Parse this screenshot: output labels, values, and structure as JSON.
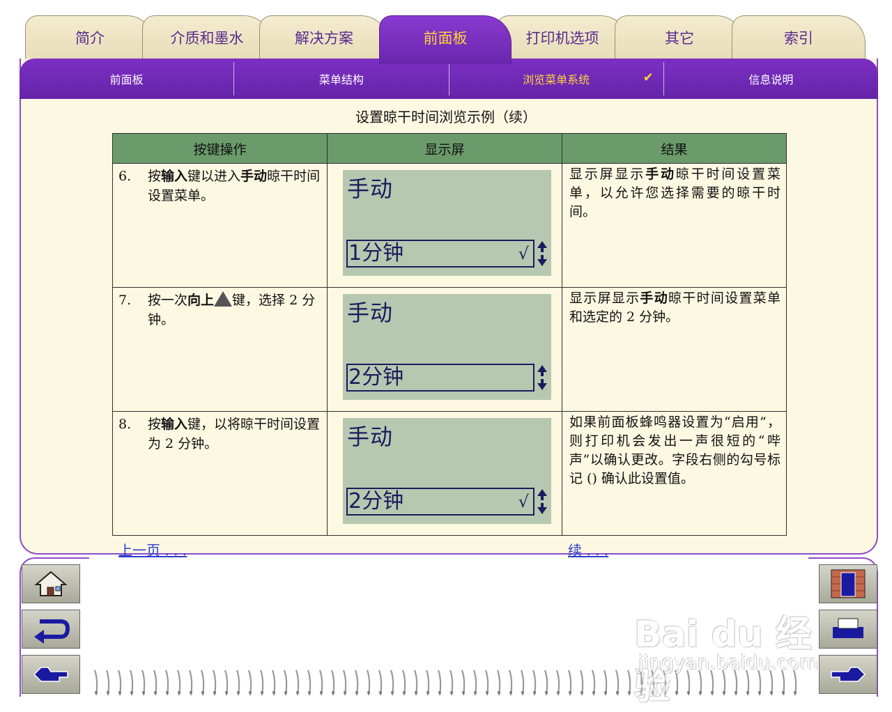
{
  "tabs": [
    {
      "label": "简介"
    },
    {
      "label": "介质和墨水"
    },
    {
      "label": "解决方案"
    },
    {
      "label": "前面板"
    },
    {
      "label": "打印机选项"
    },
    {
      "label": "其它"
    },
    {
      "label": "索引"
    }
  ],
  "active_tab": "前面板",
  "subnav": [
    {
      "label": "前面板"
    },
    {
      "label": "菜单结构"
    },
    {
      "label": "浏览菜单系统",
      "check": "✔"
    },
    {
      "label": "信息说明"
    }
  ],
  "page_title": "设置晾干时间浏览示例（续）",
  "table": {
    "headers": [
      "按键操作",
      "显示屏",
      "结果"
    ],
    "rows": [
      {
        "num": "6.",
        "action_pre": "按",
        "action_bold1": "输入",
        "action_mid": "键以进入",
        "action_bold2": "手动",
        "action_post": "晾干时间设置菜单。",
        "lcd_title": "手动",
        "lcd_value": "1分钟",
        "lcd_tick": "√",
        "result_pre": "显示屏显示",
        "result_bold": "手动",
        "result_post": "晾干时间设置菜单，以允许您选择需要的晾干时间。"
      },
      {
        "num": "7.",
        "action_pre": "按一次",
        "action_bold1": "向上",
        "action_post": "键，选择 2 分钟。",
        "lcd_title": "手动",
        "lcd_value": "2分钟",
        "lcd_tick": "",
        "result_pre": "显示屏显示",
        "result_bold": "手动",
        "result_post": "晾干时间设置菜单和选定的 2 分钟。"
      },
      {
        "num": "8.",
        "action_pre": "按",
        "action_bold1": "输入",
        "action_post": "键，以将晾干时间设置为 2 分钟。",
        "lcd_title": "手动",
        "lcd_value": "2分钟",
        "lcd_tick": "√",
        "result_text": "如果前面板蜂鸣器设置为“启用”，则打印机会发出一声很短的“哔声”以确认更改。字段右侧的勾号标记 () 确认此设置值。"
      }
    ]
  },
  "links": {
    "prev": "上一页 . . .",
    "next": "续 . . ."
  },
  "left_buttons": [
    "home-icon",
    "back-icon",
    "previous-hand-icon"
  ],
  "right_buttons": [
    "index-door-icon",
    "printer-icon",
    "next-hand-icon"
  ],
  "watermark": {
    "brand": "Bai du 经验",
    "url": "jingyan.baidu.com"
  },
  "colors": {
    "accent": "#7c2fc4",
    "highlight": "#ffd23c",
    "header_green": "#6b9a6b",
    "lcd_bg": "#b6c8b0",
    "panel_bg": "#fdf8e2"
  }
}
